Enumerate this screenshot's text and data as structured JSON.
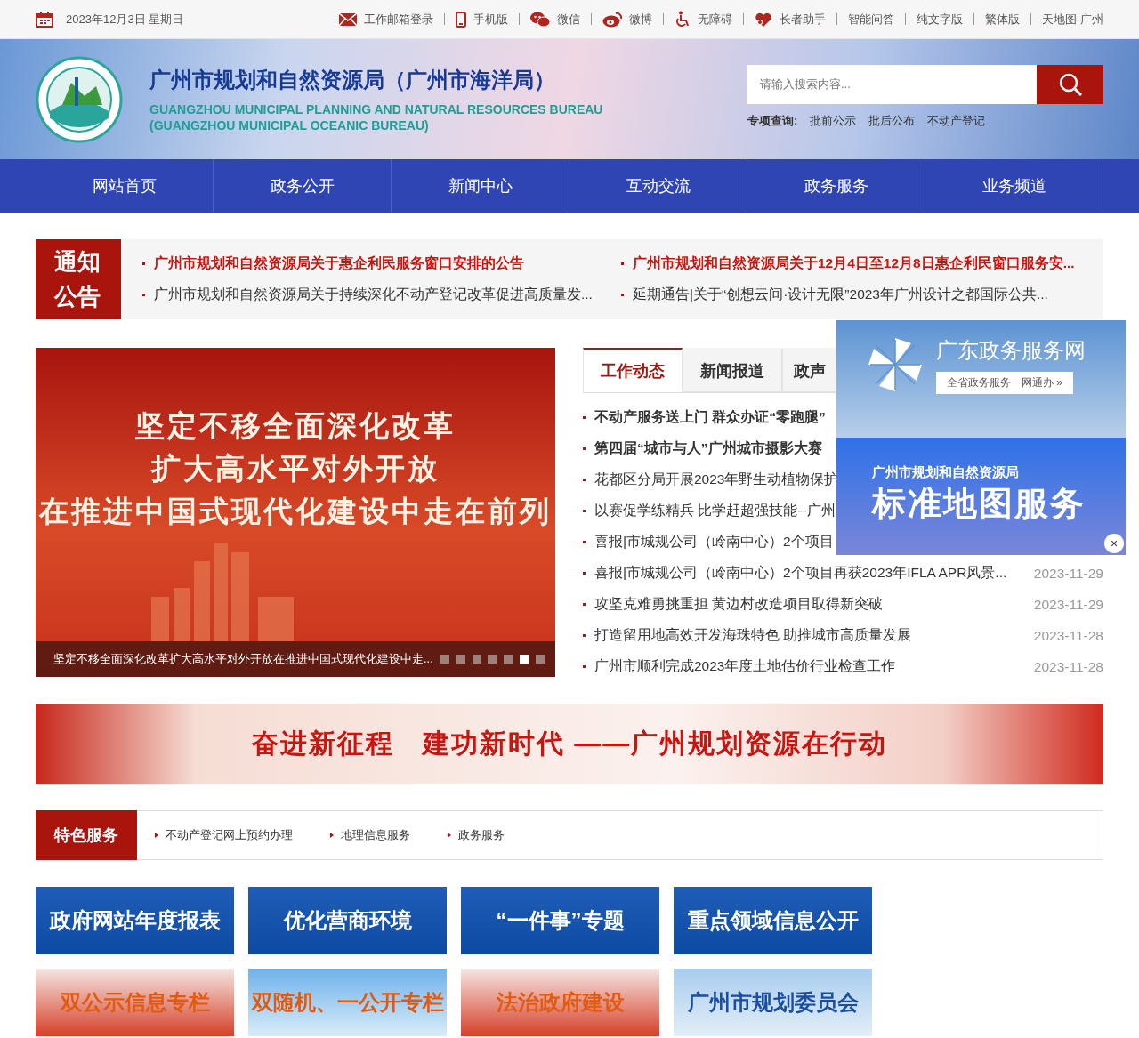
{
  "top_bar": {
    "date": "2023年12月3日 星期日",
    "links": [
      "工作邮箱登录",
      "手机版",
      "微信",
      "微博",
      "无障碍",
      "长者助手",
      "智能问答",
      "纯文字版",
      "繁体版",
      "天地图·广州"
    ]
  },
  "header": {
    "title": "广州市规划和自然资源局（广州市海洋局）",
    "subtitle_en": "GUANGZHOU MUNICIPAL PLANNING AND NATURAL RESOURCES BUREAU (GUANGZHOU MUNICIPAL OCEANIC BUREAU)",
    "search": {
      "placeholder": "请输入搜索内容..."
    },
    "special_label": "专项查询:",
    "special_links": [
      "批前公示",
      "批后公布",
      "不动产登记"
    ]
  },
  "nav": [
    "网站首页",
    "政务公开",
    "新闻中心",
    "互动交流",
    "政务服务",
    "业务频道"
  ],
  "notice": {
    "label": "通知公告",
    "items": [
      {
        "text": "广州市规划和自然资源局关于惠企利民服务窗口安排的公告",
        "highlight": true
      },
      {
        "text": "广州市规划和自然资源局关于12月4日至12月8日惠企利民窗口服务安...",
        "highlight": true
      },
      {
        "text": "广州市规划和自然资源局关于持续深化不动产登记改革促进高质量发...",
        "highlight": false
      },
      {
        "text": "延期通告|关于“创想云间·设计无限”2023年广州设计之都国际公共...",
        "highlight": false
      }
    ]
  },
  "slider": {
    "lines": [
      "坚定不移全面深化改革",
      "扩大高水平对外开放",
      "在推进中国式现代化建设中走在前列"
    ],
    "caption": "坚定不移全面深化改革扩大高水平对外开放在推进中国式现代化建设中走...",
    "dots": [
      {
        "selected": false
      },
      {
        "selected": false
      },
      {
        "selected": false
      },
      {
        "selected": false
      },
      {
        "selected": false
      },
      {
        "selected": true
      },
      {
        "selected": false
      }
    ]
  },
  "tabs": [
    {
      "label": "工作动态",
      "selected": true
    },
    {
      "label": "新闻报道",
      "selected": false
    },
    {
      "label": "政声",
      "selected": false
    }
  ],
  "news": [
    {
      "title": "不动产服务送上门 群众办证“零跑腿”",
      "bold": true
    },
    {
      "title": "第四届“城市与人”广州城市摄影大赛",
      "bold": true
    },
    {
      "title": "花都区分局开展2023年野生动植物保护",
      "bold": false
    },
    {
      "title": "以赛促学练精兵 比学赶超强技能--广州",
      "bold": false
    },
    {
      "title": "喜报|市城规公司（岭南中心）2个项目",
      "bold": false
    },
    {
      "title": "喜报|市城规公司（岭南中心）2个项目再获2023年IFLA APR风景...",
      "bold": false,
      "date": "2023-11-29"
    },
    {
      "title": "攻坚克难勇挑重担 黄边村改造项目取得新突破",
      "bold": false,
      "date": "2023-11-29"
    },
    {
      "title": "打造留用地高效开发海珠特色 助推城市高质量发展",
      "bold": false,
      "date": "2023-11-28"
    },
    {
      "title": "广州市顺利完成2023年度土地估价行业检查工作",
      "bold": false,
      "date": "2023-11-28"
    }
  ],
  "float_ad": {
    "top_title": "广东政务服务网",
    "top_button": "全省政务服务一网通办 »",
    "bottom_subtitle": "广州市规划和自然资源局",
    "bottom_title": "标准地图服务",
    "close": "×"
  },
  "banner": {
    "text": "奋进新征程　建功新时代 ——广州规划资源在行动"
  },
  "features": {
    "label": "特色服务",
    "links": [
      "不动产登记网上预约办理",
      "地理信息服务",
      "政务服务"
    ]
  },
  "tiles": [
    {
      "text": "政府网站年度报表",
      "kind": "blue"
    },
    {
      "text": "优化营商环境",
      "kind": "blue"
    },
    {
      "text": "“一件事”专题",
      "kind": "blue"
    },
    {
      "text": "重点领域信息公开",
      "kind": "blue"
    },
    {
      "text": "双公示信息专栏",
      "kind": "red"
    },
    {
      "text": "双随机、一公开专栏",
      "kind": "sky"
    },
    {
      "text": "法治政府建设",
      "kind": "red"
    },
    {
      "text": "广州市规划委员会",
      "kind": "city"
    }
  ]
}
